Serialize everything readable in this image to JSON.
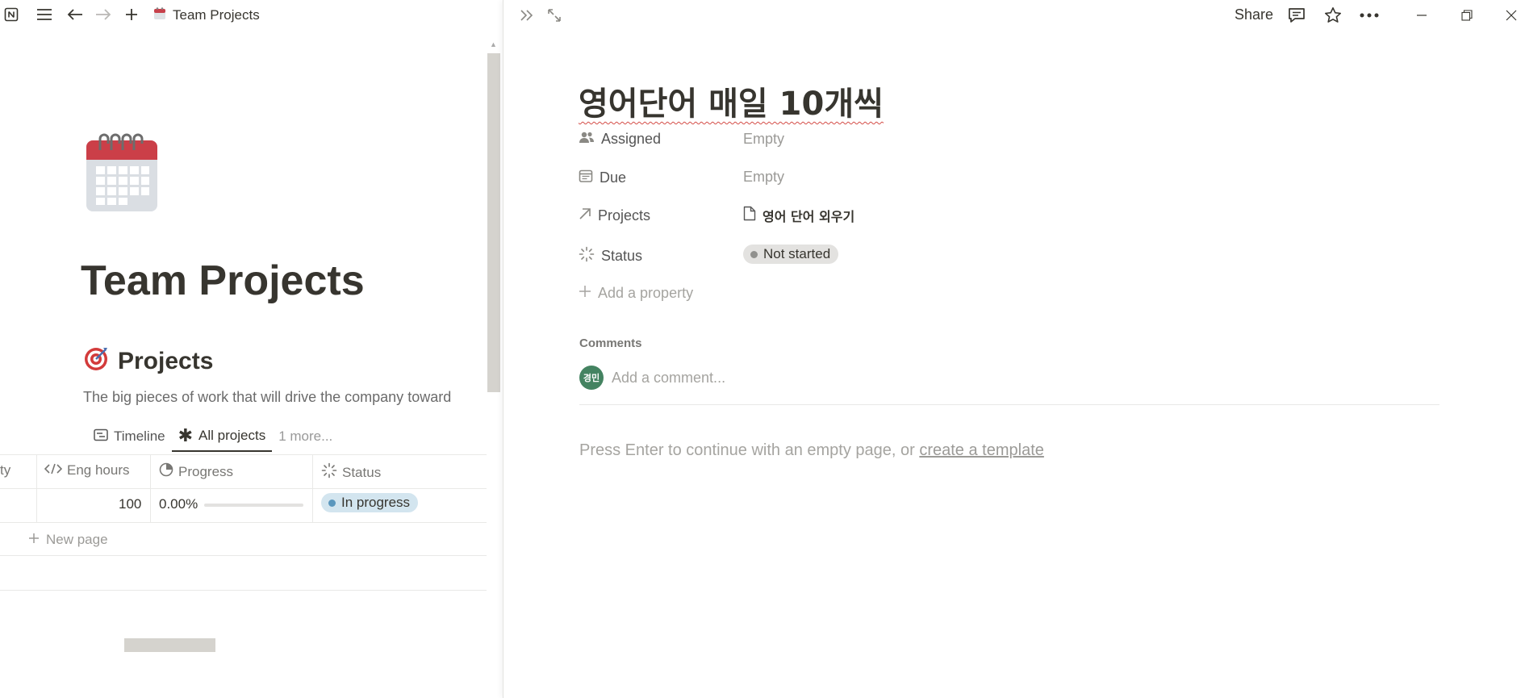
{
  "left": {
    "breadcrumb": {
      "title": "Team Projects",
      "icon": "calendar-icon"
    },
    "page": {
      "title": "Team Projects",
      "icon": "spiral-calendar-icon"
    },
    "section": {
      "title": "Projects",
      "icon": "target-icon",
      "description": "The big pieces of work that will drive the company toward"
    },
    "tabs": [
      {
        "label": "Timeline",
        "icon": "timeline-icon"
      },
      {
        "label": "All projects",
        "icon": "asterisk-icon",
        "active": true
      },
      {
        "label": "1 more...",
        "icon": ""
      }
    ],
    "table": {
      "columns": [
        {
          "label": "ty",
          "icon": ""
        },
        {
          "label": "Eng hours",
          "icon": "code-icon"
        },
        {
          "label": "Progress",
          "icon": "progress-icon"
        },
        {
          "label": "Status",
          "icon": "status-icon"
        }
      ],
      "rows": [
        {
          "eng_hours": "100",
          "progress": "0.00%",
          "progress_value": 0.0,
          "status": "In progress"
        }
      ],
      "new_page_label": "New page"
    }
  },
  "peek": {
    "share_label": "Share",
    "title": "영어단어 매일 10개씩",
    "properties": [
      {
        "name": "Assigned",
        "icon": "people-icon",
        "value": "Empty"
      },
      {
        "name": "Due",
        "icon": "calendar-date-icon",
        "value": "Empty"
      },
      {
        "name": "Projects",
        "icon": "relation-arrow-icon",
        "value": "영어 단어 외우기"
      },
      {
        "name": "Status",
        "icon": "status-icon",
        "value": "Not started"
      }
    ],
    "add_property_label": "Add a property",
    "comments_heading": "Comments",
    "avatar_initials": "경민",
    "comment_placeholder": "Add a comment...",
    "empty_hint": "Press Enter to continue with an empty page, or",
    "template_link": "create a template"
  },
  "colors": {
    "in_progress_bg": "#d3e5ef",
    "in_progress_dot": "#5b97bd",
    "not_started_bg": "#e3e2e0",
    "not_started_dot": "#91918e",
    "avatar_bg": "#448361"
  }
}
